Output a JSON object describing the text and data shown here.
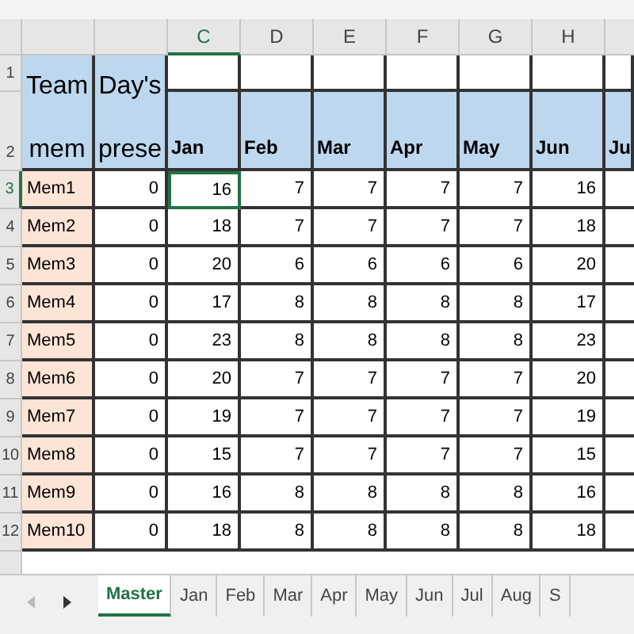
{
  "column_headers": [
    {
      "label": "C",
      "selected": true
    },
    {
      "label": "D",
      "selected": false
    },
    {
      "label": "E",
      "selected": false
    },
    {
      "label": "F",
      "selected": false
    },
    {
      "label": "G",
      "selected": false
    },
    {
      "label": "H",
      "selected": false
    }
  ],
  "header_cells": [
    "Team mem",
    "Day's prese"
  ],
  "months": [
    "Jan",
    "Feb",
    "Mar",
    "Apr",
    "May",
    "Jun",
    "Ju"
  ],
  "rows": [
    {
      "row": "3",
      "selected": true,
      "name": "Mem1",
      "days": "0",
      "values": [
        "16",
        "7",
        "7",
        "7",
        "7",
        "16"
      ]
    },
    {
      "row": "4",
      "selected": false,
      "name": "Mem2",
      "days": "0",
      "values": [
        "18",
        "7",
        "7",
        "7",
        "7",
        "18"
      ]
    },
    {
      "row": "5",
      "selected": false,
      "name": "Mem3",
      "days": "0",
      "values": [
        "20",
        "6",
        "6",
        "6",
        "6",
        "20"
      ]
    },
    {
      "row": "6",
      "selected": false,
      "name": "Mem4",
      "days": "0",
      "values": [
        "17",
        "8",
        "8",
        "8",
        "8",
        "17"
      ]
    },
    {
      "row": "7",
      "selected": false,
      "name": "Mem5",
      "days": "0",
      "values": [
        "23",
        "8",
        "8",
        "8",
        "8",
        "23"
      ]
    },
    {
      "row": "8",
      "selected": false,
      "name": "Mem6",
      "days": "0",
      "values": [
        "20",
        "7",
        "7",
        "7",
        "7",
        "20"
      ]
    },
    {
      "row": "9",
      "selected": false,
      "name": "Mem7",
      "days": "0",
      "values": [
        "19",
        "7",
        "7",
        "7",
        "7",
        "19"
      ]
    },
    {
      "row": "10",
      "selected": false,
      "name": "Mem8",
      "days": "0",
      "values": [
        "15",
        "7",
        "7",
        "7",
        "7",
        "15"
      ]
    },
    {
      "row": "11",
      "selected": false,
      "name": "Mem9",
      "days": "0",
      "values": [
        "16",
        "8",
        "8",
        "8",
        "8",
        "16"
      ]
    },
    {
      "row": "12",
      "selected": false,
      "name": "Mem10",
      "days": "0",
      "values": [
        "18",
        "8",
        "8",
        "8",
        "8",
        "18"
      ]
    }
  ],
  "top_row_headers": [
    "1",
    "2"
  ],
  "tabs": [
    {
      "label": "Master",
      "selected": true
    },
    {
      "label": "Jan",
      "selected": false
    },
    {
      "label": "Feb",
      "selected": false
    },
    {
      "label": "Mar",
      "selected": false
    },
    {
      "label": "Apr",
      "selected": false
    },
    {
      "label": "May",
      "selected": false
    },
    {
      "label": "Jun",
      "selected": false
    },
    {
      "label": "Jul",
      "selected": false
    },
    {
      "label": "Aug",
      "selected": false
    },
    {
      "label": "S",
      "selected": false
    }
  ]
}
